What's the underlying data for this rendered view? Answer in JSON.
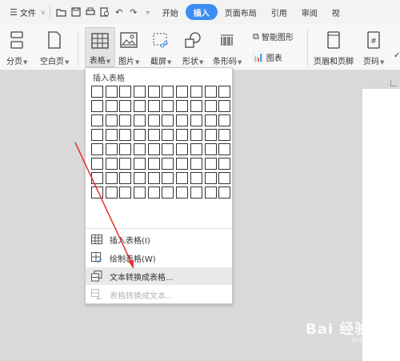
{
  "menubar": {
    "file_label": "文件",
    "tabs": [
      "开始",
      "插入",
      "页面布局",
      "引用",
      "审阅",
      "视"
    ],
    "active_tab": "插入"
  },
  "ribbon": {
    "buttons": {
      "page_break": "分页",
      "blank_page": "空白页",
      "table": "表格",
      "picture": "图片",
      "screenshot": "截屏",
      "shape": "形状",
      "barcode": "条形码",
      "smartart": "智能图形",
      "chart": "图表",
      "header_footer": "页眉和页脚",
      "page_number": "页码",
      "more": "✓"
    }
  },
  "dropdown": {
    "title": "插入表格",
    "grid": {
      "columns": 10,
      "rows": 8
    },
    "items": [
      {
        "label": "插入表格(I)",
        "icon": "table-insert-icon",
        "enabled": true
      },
      {
        "label": "绘制表格(W)",
        "icon": "draw-table-icon",
        "enabled": true
      },
      {
        "label": "文本转换成表格...",
        "icon": "text-to-table-icon",
        "enabled": true,
        "highlighted": true
      },
      {
        "label": "表格转换成文本...",
        "icon": "table-to-text-icon",
        "enabled": false
      }
    ]
  },
  "colors": {
    "active_tab": "#3b8ef2",
    "arrow": "#e0332b"
  },
  "watermark": {
    "text": "Bai 经验",
    "sub": "jingyan.baidu.com"
  }
}
